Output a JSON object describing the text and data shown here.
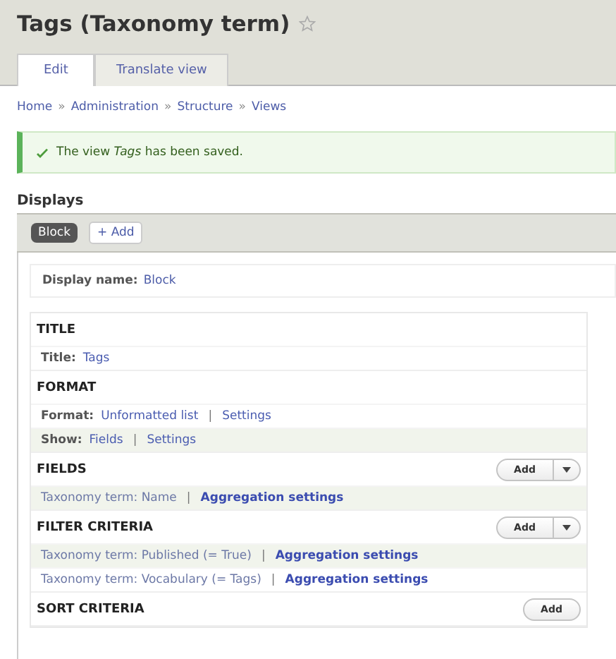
{
  "page_title": "Tags (Taxonomy term)",
  "tabs": [
    {
      "label": "Edit",
      "selected": true
    },
    {
      "label": "Translate view",
      "selected": false
    }
  ],
  "breadcrumb": [
    {
      "text": "Home",
      "kind": "link"
    },
    {
      "text": "»",
      "kind": "sep"
    },
    {
      "text": "Administration",
      "kind": "link"
    },
    {
      "text": "»",
      "kind": "sep"
    },
    {
      "text": "Structure",
      "kind": "link"
    },
    {
      "text": "»",
      "kind": "sep"
    },
    {
      "text": "Views",
      "kind": "link"
    }
  ],
  "message": {
    "kind": "status",
    "text": "The view *Tags* has been saved."
  },
  "displays": {
    "heading": "Displays",
    "items": [
      {
        "label": "Block",
        "selected": true
      }
    ],
    "add_button": "+ Add"
  },
  "display_name": {
    "label": "Display name:",
    "value": "Block"
  },
  "sections": [
    {
      "title": "TITLE",
      "rows": [
        {
          "highlighted": false,
          "parts": [
            {
              "kind": "label",
              "text": "Title:"
            },
            {
              "kind": "link",
              "text": "Tags"
            }
          ]
        }
      ]
    },
    {
      "title": "FORMAT",
      "rows": [
        {
          "highlighted": false,
          "parts": [
            {
              "kind": "label",
              "text": "Format:"
            },
            {
              "kind": "link",
              "text": "Unformatted list"
            },
            {
              "kind": "sep",
              "text": "|"
            },
            {
              "kind": "link",
              "text": "Settings"
            }
          ]
        },
        {
          "highlighted": true,
          "parts": [
            {
              "kind": "label",
              "text": "Show:"
            },
            {
              "kind": "link",
              "text": "Fields"
            },
            {
              "kind": "sep",
              "text": "|"
            },
            {
              "kind": "link",
              "text": "Settings"
            }
          ]
        }
      ]
    },
    {
      "title": "FIELDS",
      "add": {
        "label": "Add",
        "split": true
      },
      "rows": [
        {
          "highlighted": true,
          "parts": [
            {
              "kind": "item",
              "text": "Taxonomy term: Name"
            },
            {
              "kind": "sep",
              "text": "|"
            },
            {
              "kind": "strong",
              "text": "Aggregation settings"
            }
          ]
        }
      ]
    },
    {
      "title": "FILTER CRITERIA",
      "add": {
        "label": "Add",
        "split": true
      },
      "rows": [
        {
          "highlighted": true,
          "parts": [
            {
              "kind": "item",
              "text": "Taxonomy term: Published (= True)"
            },
            {
              "kind": "sep",
              "text": "|"
            },
            {
              "kind": "strong",
              "text": "Aggregation settings"
            }
          ]
        },
        {
          "highlighted": false,
          "parts": [
            {
              "kind": "item",
              "text": "Taxonomy term: Vocabulary (= Tags)"
            },
            {
              "kind": "sep",
              "text": "|"
            },
            {
              "kind": "strong",
              "text": "Aggregation settings"
            }
          ]
        }
      ]
    },
    {
      "title": "SORT CRITERIA",
      "add": {
        "label": "Add",
        "split": false
      }
    }
  ]
}
